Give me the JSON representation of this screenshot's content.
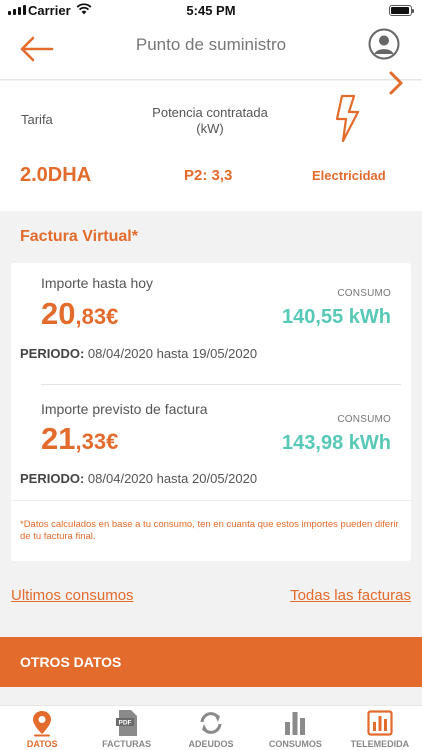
{
  "status_bar": {
    "carrier": "Carrier",
    "time": "5:45 PM"
  },
  "header": {
    "title": "Punto de suministro"
  },
  "supply": {
    "tarifa_label": "Tarifa",
    "tarifa_value": "2.0DHA",
    "potencia_label_1": "Potencia contratada",
    "potencia_label_2": "(kW)",
    "potencia_value": "P2: 3,3",
    "type_value": "Electricidad"
  },
  "factura": {
    "title": "Factura Virtual*",
    "current": {
      "label": "Importe hasta hoy",
      "amount_int": "20",
      "amount_dec": ",83€",
      "consumo_label": "CONSUMO",
      "consumo_value": "140,55 kWh",
      "periodo_label": "PERIODO:",
      "periodo_value": "08/04/2020 hasta 19/05/2020"
    },
    "forecast": {
      "label": "Importe previsto de factura",
      "amount_int": "21",
      "amount_dec": ",33€",
      "consumo_label": "CONSUMO",
      "consumo_value": "143,98 kWh",
      "periodo_label": "PERIODO:",
      "periodo_value": "08/04/2020 hasta 20/05/2020"
    },
    "note": "*Datos calculados en base a tu consumo, ten en cuanta que estos importes pueden diferir de tu factura final."
  },
  "links": {
    "ultimos": "Ultimos consumos",
    "todas": "Todas las facturas"
  },
  "otros_datos": "OTROS DATOS",
  "tabs": [
    {
      "label": "DATOS",
      "icon": "location-pin-icon",
      "active": true
    },
    {
      "label": "FACTURAS",
      "icon": "pdf-icon",
      "active": false
    },
    {
      "label": "ADEUDOS",
      "icon": "sync-icon",
      "active": false
    },
    {
      "label": "CONSUMOS",
      "icon": "bar-chart-icon",
      "active": false
    },
    {
      "label": "TELEMEDIDA",
      "icon": "telemedida-chart-icon",
      "active": false
    }
  ],
  "colors": {
    "accent": "#e36b2c",
    "kwh": "#57c9b6",
    "background": "#f2f2f2"
  }
}
